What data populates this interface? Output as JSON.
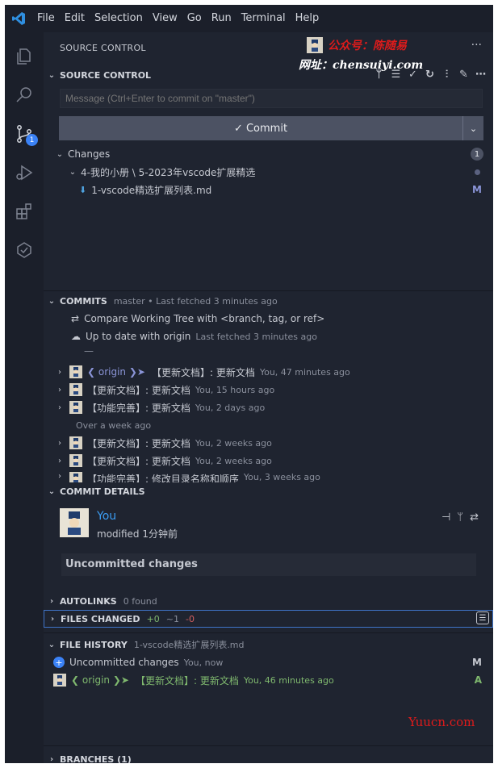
{
  "menu": [
    "File",
    "Edit",
    "Selection",
    "View",
    "Go",
    "Run",
    "Terminal",
    "Help"
  ],
  "activity": {
    "scm_badge": "1"
  },
  "sidebar": {
    "title": "SOURCE CONTROL",
    "more": "···"
  },
  "watermark": {
    "line1": "公众号：陈随易",
    "line2": "网址：chensuiyi.com",
    "corner": "Yuucn.com"
  },
  "scm": {
    "header": "SOURCE CONTROL",
    "commit_placeholder": "Message (Ctrl+Enter to commit on \"master\")",
    "commit_label": "✓ Commit",
    "changes_label": "Changes",
    "changes_count": "1",
    "folder": "4-我的小册 \\ 5-2023年vscode扩展精选",
    "file": "1-vscode精选扩展列表.md",
    "file_status": "M"
  },
  "commits": {
    "header": "COMMITS",
    "sub": "master • Last fetched 3 minutes ago",
    "compare": "Compare Working Tree with <branch, tag, or ref>",
    "uptodate": "Up to date with origin",
    "uptodate_sub": "Last fetched 3 minutes ago",
    "divider": "—",
    "group_label": "Over a week ago",
    "origin_tag": "❮ origin ❯➤",
    "items": [
      {
        "msg": "【更新文档】: 更新文档",
        "meta": "You, 47 minutes ago"
      },
      {
        "msg": "【更新文档】: 更新文档",
        "meta": "You, 15 hours ago"
      },
      {
        "msg": "【功能完善】: 更新文档",
        "meta": "You, 2 days ago"
      },
      {
        "msg": "【更新文档】: 更新文档",
        "meta": "You, 2 weeks ago"
      },
      {
        "msg": "【更新文档】: 更新文档",
        "meta": "You, 2 weeks ago"
      },
      {
        "msg": "【功能完善】: 修改目录名称和顺序",
        "meta": "You, 3 weeks ago"
      }
    ]
  },
  "details": {
    "header": "COMMIT DETAILS",
    "author": "You",
    "modified": "modified 1分钟前",
    "box": "Uncommitted changes"
  },
  "autolinks": {
    "label": "AUTOLINKS",
    "sub": "0 found"
  },
  "files_changed": {
    "label": "FILES CHANGED",
    "add": "+0",
    "mod": "~1",
    "del": "-0"
  },
  "history": {
    "label": "FILE HISTORY",
    "sub": "1-vscode精选扩展列表.md",
    "row1": "Uncommitted changes",
    "row1_meta": "You, now",
    "row1_status": "M",
    "row2_tag": "❮ origin ❯➤",
    "row2_msg": "【更新文档】: 更新文档",
    "row2_meta": "You, 46 minutes ago",
    "row2_status": "A"
  },
  "branches": {
    "label": "BRANCHES (1)"
  }
}
